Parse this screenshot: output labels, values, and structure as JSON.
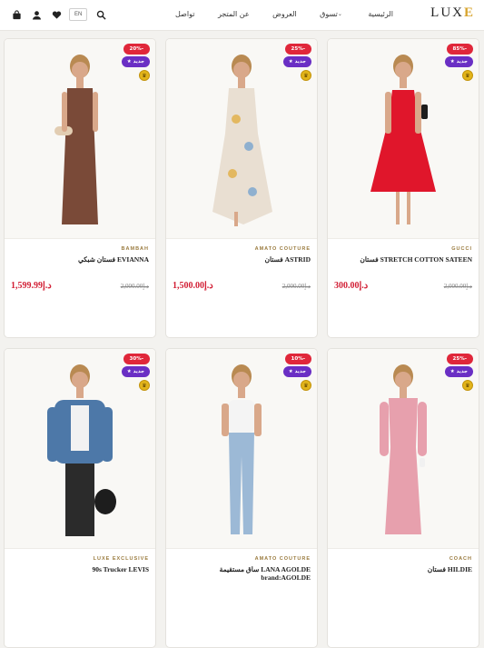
{
  "header": {
    "logo_main": "LUX",
    "logo_accent": "E",
    "lang": "EN",
    "nav": [
      {
        "label": "الرئيسية"
      },
      {
        "label": "تسوق",
        "caret": "⌄"
      },
      {
        "label": "العروض"
      },
      {
        "label": "عن المتجر"
      },
      {
        "label": "تواصل"
      }
    ],
    "icons": [
      "bag-icon",
      "user-icon",
      "heart-icon",
      "search-icon"
    ]
  },
  "badges": {
    "new": "★ جديد",
    "gold": "♛"
  },
  "products": [
    {
      "brand": "BAMBAH",
      "name": "فستان شبكي EVIANNA",
      "price": "1,599.99د.إ",
      "old_price": "2,000.00د.إ",
      "discount": "20%-",
      "dress_color": "#7a4a38",
      "style": "long"
    },
    {
      "brand": "AMATO COUTURE",
      "name": "فستان ASTRID",
      "price": "1,500.00د.إ",
      "old_price": "2,000.00د.إ",
      "discount": "25%-",
      "dress_color": "#e9dfd2",
      "style": "floral"
    },
    {
      "brand": "GUCCI",
      "name": "فستان STRETCH COTTON SATEEN",
      "price": "300.00د.إ",
      "old_price": "2,000.00د.إ",
      "discount": "85%-",
      "dress_color": "#e0162b",
      "style": "midi"
    },
    {
      "brand": "LUXE EXCLUSIVE",
      "name": "90s Trucker LEVIS",
      "price": "",
      "old_price": "",
      "discount": "30%-",
      "dress_color": "#4d78a8",
      "style": "jacket"
    },
    {
      "brand": "AMATO COUTURE",
      "name": "ساق مستقيمة LANA AGOLDE brand:AGOLDE",
      "price": "",
      "old_price": "",
      "discount": "10%-",
      "dress_color": "#9cb9d6",
      "style": "jeans"
    },
    {
      "brand": "COACH",
      "name": "فستان HILDIE",
      "price": "",
      "old_price": "",
      "discount": "25%-",
      "dress_color": "#e7a0ad",
      "style": "pink"
    }
  ]
}
